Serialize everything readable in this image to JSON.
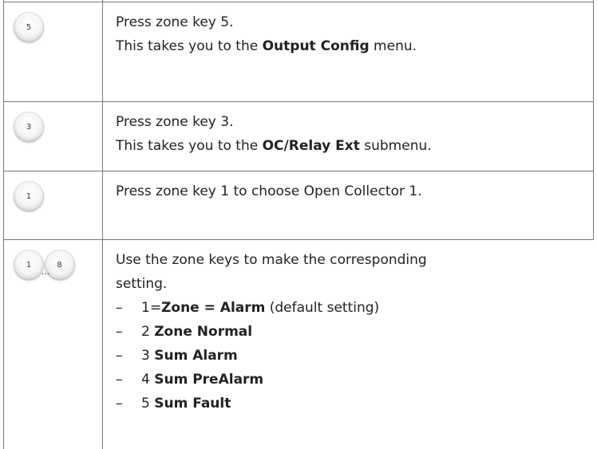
{
  "steps": [
    {
      "keys": [
        "5"
      ],
      "line1": "Press zone key 5.",
      "line2_pre": "This takes you to the ",
      "line2_bold": "Output Config",
      "line2_post": " menu."
    },
    {
      "keys": [
        "3"
      ],
      "line1": "Press zone key 3.",
      "line2_pre": "This takes you to the ",
      "line2_bold": "OC/Relay Ext",
      "line2_post": " submenu."
    },
    {
      "keys": [
        "1"
      ],
      "line1": "Press zone key 1 to choose Open Collector 1."
    },
    {
      "keys": [
        "1",
        "8"
      ],
      "key_separator": "...",
      "line1": "Use the zone keys to make the corresponding",
      "line2": "setting.",
      "bullet_marker": "–",
      "options": [
        {
          "pre": "1=",
          "bold": "Zone = Alarm",
          "post": " (default setting)"
        },
        {
          "pre": "2 ",
          "bold": "Zone Normal",
          "post": ""
        },
        {
          "pre": "3 ",
          "bold": "Sum Alarm",
          "post": ""
        },
        {
          "pre": "4 ",
          "bold": "Sum PreAlarm",
          "post": ""
        },
        {
          "pre": "5 ",
          "bold": "Sum Fault",
          "post": ""
        }
      ]
    }
  ]
}
